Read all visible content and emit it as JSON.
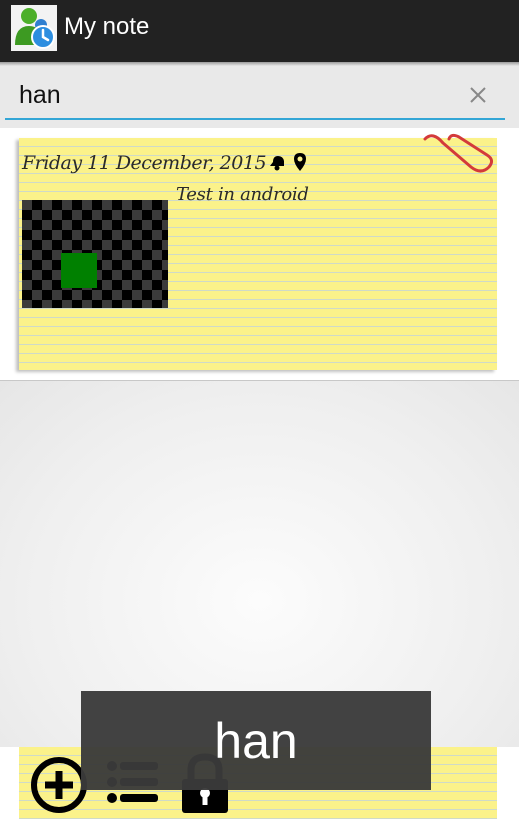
{
  "app": {
    "title": "My note",
    "icon": "messenger-person-clock-icon"
  },
  "search": {
    "value": "han",
    "placeholder": "",
    "clear_icon": "close-icon",
    "accent_color": "#33a6d6"
  },
  "notes": [
    {
      "date": "Friday 11 December, 2015",
      "title": "Test in android",
      "has_reminder": true,
      "has_location": true,
      "has_image": true,
      "icons": [
        "bell-icon",
        "location-pin-icon",
        "paperclip-icon"
      ],
      "paper_color": "#fbf28a"
    }
  ],
  "bottom_toolbar": {
    "buttons": [
      "add-circle-icon",
      "list-icon",
      "lock-icon"
    ]
  },
  "toast": {
    "text": "han"
  }
}
